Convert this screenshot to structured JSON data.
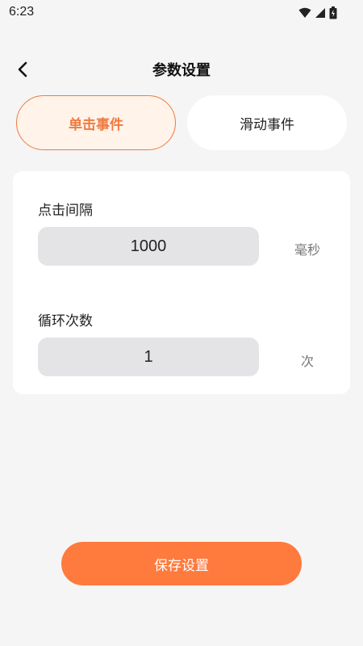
{
  "status_bar": {
    "time": "6:23",
    "icons": [
      "wifi-icon",
      "signal-icon",
      "battery-icon"
    ]
  },
  "header": {
    "back_icon": "chevron-left-icon",
    "title": "参数设置"
  },
  "tabs": [
    {
      "label": "单击事件",
      "active": true
    },
    {
      "label": "滑动事件",
      "active": false
    }
  ],
  "settings": {
    "interval": {
      "label": "点击间隔",
      "value": "1000",
      "unit": "毫秒"
    },
    "loop": {
      "label": "循环次数",
      "value": "1",
      "unit": "次"
    }
  },
  "save_button": {
    "label": "保存设置"
  },
  "colors": {
    "accent": "#ff7a3d",
    "accent_border": "#f07a40",
    "tab_active_bg": "#fff3ea",
    "background": "#f5f5f5",
    "input_bg": "#e4e4e6"
  }
}
